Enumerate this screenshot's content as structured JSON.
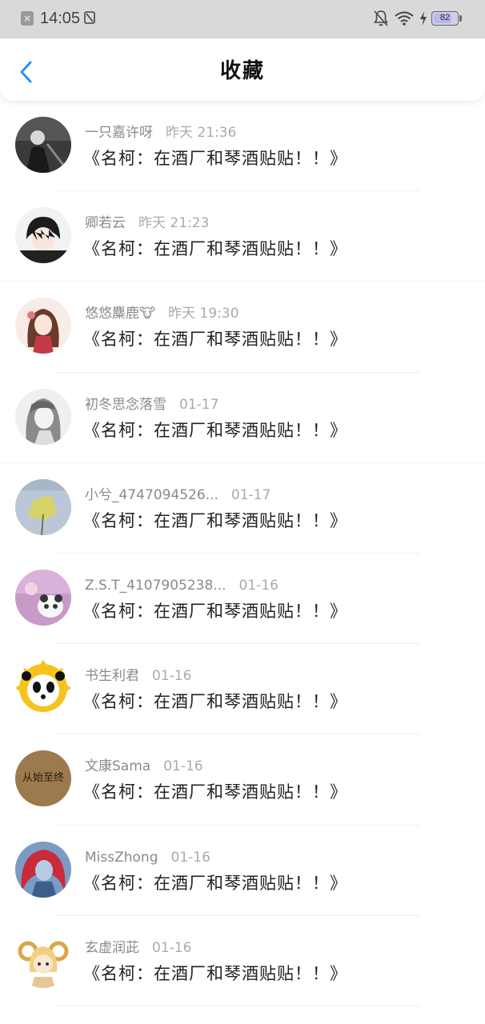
{
  "status_bar": {
    "notification_icon": "close-box-icon",
    "time": "14:05",
    "battery_level": "82",
    "battery_fraction": 0.82
  },
  "header": {
    "back_icon": "chevron-left-icon",
    "title": "收藏",
    "accent_color": "#2f8ff0"
  },
  "favorites": [
    {
      "username": "一只嘉许呀",
      "time": "昨天 21:36",
      "title": "《名柯：在酒厂和琴酒贴贴！！》",
      "avatar": "dark-silhouette-avatar"
    },
    {
      "username": "卿若云",
      "time": "昨天 21:23",
      "title": "《名柯：在酒厂和琴酒贴贴！！》",
      "avatar": "anime-boy-avatar"
    },
    {
      "username": "悠悠麋鹿🐮",
      "time": "昨天 19:30",
      "title": "《名柯：在酒厂和琴酒贴贴！！》",
      "avatar": "anime-girl-red-avatar"
    },
    {
      "username": "初冬思念落雪",
      "time": "01-17",
      "title": "《名柯：在酒厂和琴酒贴贴！！》",
      "avatar": "anime-girl-grey-avatar"
    },
    {
      "username": "小兮_4747094526...",
      "time": "01-17",
      "title": "《名柯：在酒厂和琴酒贴贴！！》",
      "avatar": "yellow-flower-avatar"
    },
    {
      "username": "Z.S.T_4107905238...",
      "time": "01-16",
      "title": "《名柯：在酒厂和琴酒贴贴！！》",
      "avatar": "pink-panda-avatar"
    },
    {
      "username": "书生利君",
      "time": "01-16",
      "title": "《名柯：在酒厂和琴酒贴贴！！》",
      "avatar": "panda-sun-avatar"
    },
    {
      "username": "文康Sama",
      "time": "01-16",
      "title": "《名柯：在酒厂和琴酒贴贴！！》",
      "avatar": "text-avatar",
      "avatar_text": "从始至终"
    },
    {
      "username": "MissZhong",
      "time": "01-16",
      "title": "《名柯：在酒厂和琴酒贴贴！！》",
      "avatar": "red-hair-girl-avatar"
    },
    {
      "username": "玄虚润茈",
      "time": "01-16",
      "title": "《名柯：在酒厂和琴酒贴贴！！》",
      "avatar": "ram-horn-chibi-avatar"
    }
  ]
}
